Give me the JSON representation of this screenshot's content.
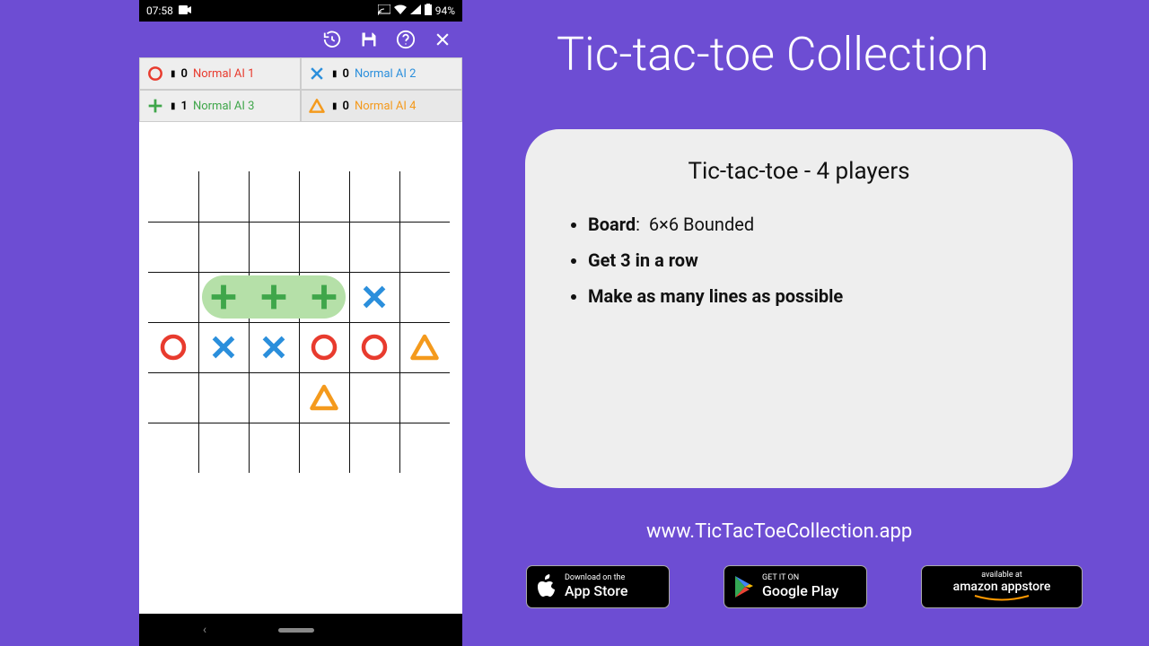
{
  "statusbar": {
    "time": "07:58",
    "battery_pct": "94%"
  },
  "appbar_icons": [
    "history-icon",
    "save-icon",
    "help-icon",
    "close-icon"
  ],
  "players": [
    {
      "symbol": "circle",
      "color": "#e83b2e",
      "score": "0",
      "name": "Normal AI 1"
    },
    {
      "symbol": "cross",
      "color": "#2b8fdc",
      "score": "0",
      "name": "Normal AI 2"
    },
    {
      "symbol": "plus",
      "color": "#3fa64a",
      "score": "1",
      "name": "Normal AI 3"
    },
    {
      "symbol": "triangle",
      "color": "#f49a1d",
      "score": "0",
      "name": "Normal AI 4"
    }
  ],
  "board": {
    "size": 6,
    "highlight": {
      "row": 2,
      "col_start": 1,
      "col_end": 3
    },
    "cells": [
      [
        null,
        null,
        null,
        null,
        null,
        null
      ],
      [
        null,
        null,
        null,
        null,
        null,
        null
      ],
      [
        null,
        "plus",
        "plus",
        "plus",
        "cross",
        null
      ],
      [
        "circle",
        "cross",
        "cross",
        "circle",
        "circle",
        "triangle"
      ],
      [
        null,
        null,
        null,
        "triangle",
        null,
        null
      ],
      [
        null,
        null,
        null,
        null,
        null,
        null
      ]
    ]
  },
  "title": "Tic-tac-toe Collection",
  "card": {
    "heading": "Tic-tac-toe - 4 players",
    "bullets": [
      {
        "bold": "Board",
        "rest": ":  6×6 Bounded"
      },
      {
        "bold": "Get 3 in a row",
        "rest": ""
      },
      {
        "bold": "Make as many lines as possible",
        "rest": ""
      }
    ]
  },
  "url": "www.TicTacToeCollection.app",
  "stores": {
    "apple": {
      "small": "Download on the",
      "big": "App Store"
    },
    "google": {
      "small": "GET IT ON",
      "big": "Google Play"
    },
    "amazon": {
      "small": "available at",
      "big": "amazon appstore"
    }
  }
}
